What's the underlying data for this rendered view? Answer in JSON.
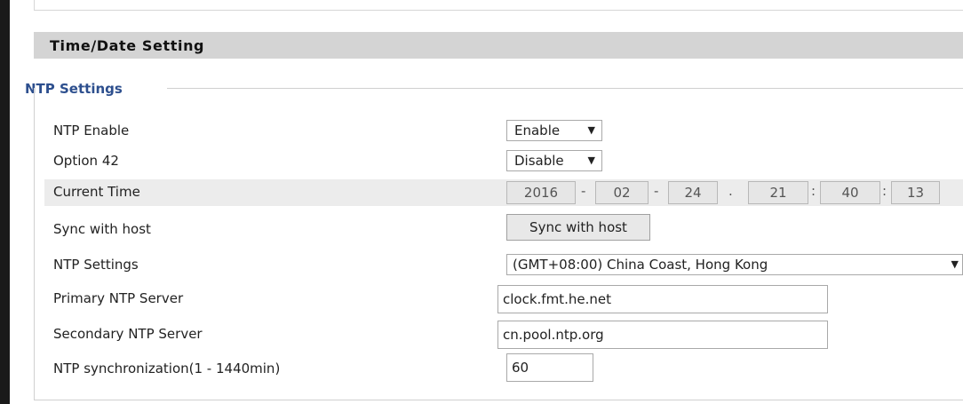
{
  "section": {
    "title": "Time/Date Setting"
  },
  "group": {
    "legend": "NTP Settings"
  },
  "rows": {
    "ntp_enable": {
      "label": "NTP Enable",
      "value": "Enable"
    },
    "option42": {
      "label": "Option 42",
      "value": "Disable"
    },
    "current_time": {
      "label": "Current Time",
      "year": "2016",
      "month": "02",
      "day": "24",
      "hour": "21",
      "minute": "40",
      "second": "13",
      "sep_dash": "-",
      "sep_dot": ".",
      "sep_colon": ":"
    },
    "sync_host": {
      "label": "Sync with host",
      "button": "Sync with host"
    },
    "ntp_settings": {
      "label": "NTP Settings",
      "value": "(GMT+08:00) China Coast, Hong Kong"
    },
    "primary_server": {
      "label": "Primary NTP Server",
      "value": "clock.fmt.he.net"
    },
    "secondary_server": {
      "label": "Secondary NTP Server",
      "value": "cn.pool.ntp.org"
    },
    "ntp_sync": {
      "label": "NTP synchronization(1 - 1440min)",
      "value": "60"
    }
  },
  "icons": {
    "dropdown_arrow": "▼"
  }
}
